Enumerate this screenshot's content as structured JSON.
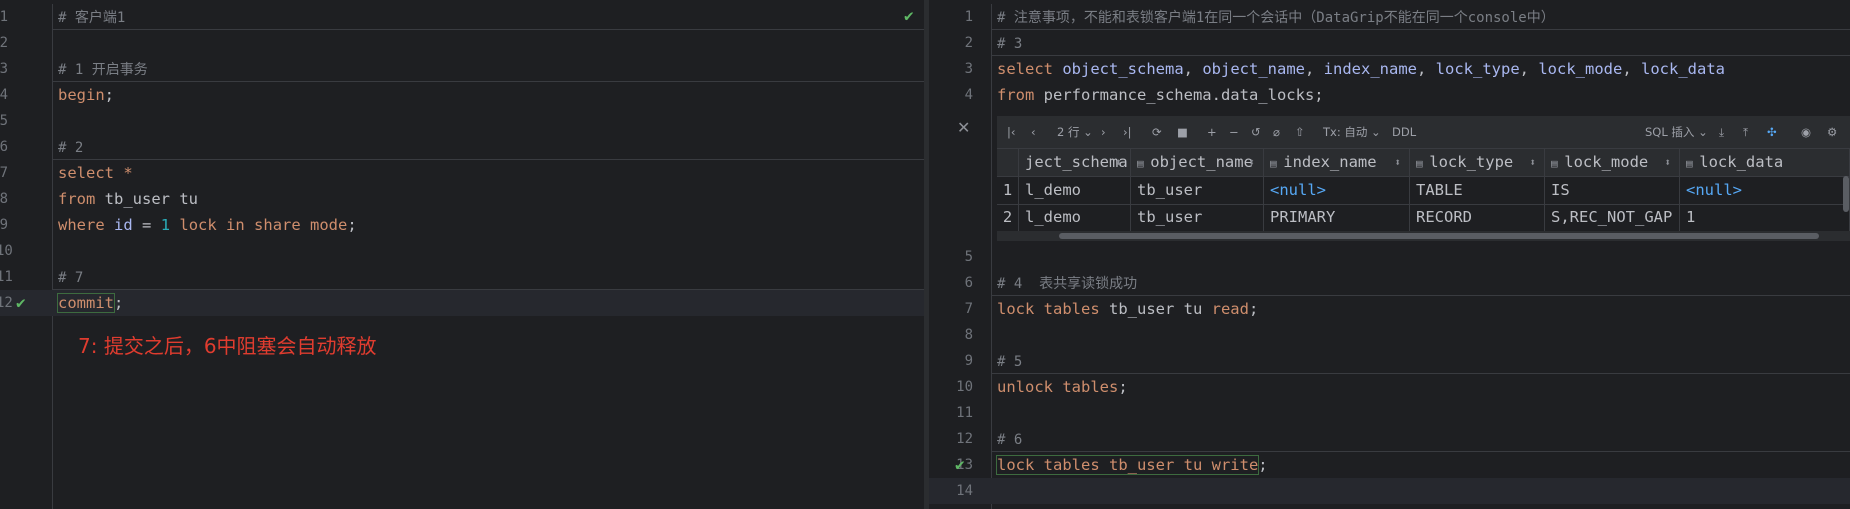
{
  "left_editor": {
    "lines": [
      {
        "n": "1",
        "segs": [
          {
            "c": "comment",
            "t": "# 客户端1"
          }
        ],
        "sep": true
      },
      {
        "n": "2",
        "segs": []
      },
      {
        "n": "3",
        "segs": [
          {
            "c": "comment",
            "t": "# 1 开启事务"
          }
        ],
        "sep": true
      },
      {
        "n": "4",
        "segs": [
          {
            "c": "kw",
            "t": "begin"
          },
          {
            "c": "id",
            "t": ";"
          }
        ]
      },
      {
        "n": "5",
        "segs": []
      },
      {
        "n": "6",
        "segs": [
          {
            "c": "comment",
            "t": "# 2"
          }
        ],
        "sep": true
      },
      {
        "n": "7",
        "segs": [
          {
            "c": "kw",
            "t": "select"
          },
          {
            "c": "id",
            "t": " "
          },
          {
            "c": "kw",
            "t": "*"
          }
        ]
      },
      {
        "n": "8",
        "segs": [
          {
            "c": "kw",
            "t": "from"
          },
          {
            "c": "id",
            "t": " tb_user tu"
          }
        ]
      },
      {
        "n": "9",
        "segs": [
          {
            "c": "kw",
            "t": "where"
          },
          {
            "c": "id",
            "t": " "
          },
          {
            "c": "col",
            "t": "id"
          },
          {
            "c": "id",
            "t": " = "
          },
          {
            "c": "num",
            "t": "1"
          },
          {
            "c": "id",
            "t": " "
          },
          {
            "c": "kw",
            "t": "lock in share mode"
          },
          {
            "c": "id",
            "t": ";"
          }
        ]
      },
      {
        "n": "10",
        "segs": []
      },
      {
        "n": "11",
        "segs": [
          {
            "c": "comment",
            "t": "# 7"
          }
        ],
        "sep": true
      },
      {
        "n": "12",
        "segs": [
          {
            "c": "kw box",
            "t": "commit"
          },
          {
            "c": "id",
            "t": ";"
          }
        ],
        "check": true
      }
    ],
    "top_check": "✔",
    "annotation": "7: 提交之后，6中阻塞会自动释放"
  },
  "right_editor": {
    "lines_top": [
      {
        "n": "1",
        "segs": [
          {
            "c": "comment",
            "t": "# 注意事项，不能和表锁客户端1在同一个会话中（DataGrip不能在同一个console中）"
          }
        ],
        "sep": true
      },
      {
        "n": "2",
        "segs": [
          {
            "c": "comment",
            "t": "# 3"
          }
        ],
        "sep": true
      },
      {
        "n": "3",
        "segs": [
          {
            "c": "kw",
            "t": "select"
          },
          {
            "c": "id",
            "t": " "
          },
          {
            "c": "col",
            "t": "object_schema"
          },
          {
            "c": "id",
            "t": ", "
          },
          {
            "c": "col",
            "t": "object_name"
          },
          {
            "c": "id",
            "t": ", "
          },
          {
            "c": "col",
            "t": "index_name"
          },
          {
            "c": "id",
            "t": ", "
          },
          {
            "c": "col",
            "t": "lock_type"
          },
          {
            "c": "id",
            "t": ", "
          },
          {
            "c": "col",
            "t": "lock_mode"
          },
          {
            "c": "id",
            "t": ", "
          },
          {
            "c": "col",
            "t": "lock_data"
          }
        ]
      },
      {
        "n": "4",
        "segs": [
          {
            "c": "kw",
            "t": "from"
          },
          {
            "c": "id",
            "t": " performance_schema.data_locks;"
          }
        ]
      }
    ],
    "lines_bottom": [
      {
        "n": "5",
        "segs": []
      },
      {
        "n": "6",
        "segs": [
          {
            "c": "comment",
            "t": "# 4  表共享读锁成功"
          }
        ],
        "sep": true
      },
      {
        "n": "7",
        "segs": [
          {
            "c": "kw",
            "t": "lock tables"
          },
          {
            "c": "id",
            "t": " tb_user tu "
          },
          {
            "c": "kw",
            "t": "read"
          },
          {
            "c": "id",
            "t": ";"
          }
        ]
      },
      {
        "n": "8",
        "segs": []
      },
      {
        "n": "9",
        "segs": [
          {
            "c": "comment",
            "t": "# 5"
          }
        ],
        "sep": true
      },
      {
        "n": "10",
        "segs": [
          {
            "c": "kw",
            "t": "unlock tables"
          },
          {
            "c": "id",
            "t": ";"
          }
        ]
      },
      {
        "n": "11",
        "segs": []
      },
      {
        "n": "12",
        "segs": [
          {
            "c": "comment",
            "t": "# 6"
          }
        ],
        "sep": true
      },
      {
        "n": "13",
        "segs": [
          {
            "c": "kw box",
            "t": "lock tables tb_user tu write"
          },
          {
            "c": "id",
            "t": ";"
          }
        ],
        "check": true
      },
      {
        "n": "14",
        "segs": []
      }
    ]
  },
  "results": {
    "toolbar": {
      "rows_label": "2 行",
      "tx_label": "Tx: 自动",
      "ddl_label": "DDL",
      "sql_label": "SQL 插入"
    },
    "columns": [
      "ject_schema",
      "object_name",
      "index_name",
      "lock_type",
      "lock_mode",
      "lock_data"
    ],
    "rows": [
      {
        "n": "1",
        "cells": [
          "l_demo",
          "tb_user",
          "<null>",
          "TABLE",
          "IS",
          "<null>"
        ]
      },
      {
        "n": "2",
        "cells": [
          "l_demo",
          "tb_user",
          "PRIMARY",
          "RECORD",
          "S,REC_NOT_GAP",
          "1"
        ]
      }
    ]
  },
  "colors": {
    "background": "#1e1f22",
    "keyword": "#cf8e6d",
    "comment": "#7a7e85",
    "annotation": "#e03c2f",
    "check": "#5fb865"
  }
}
